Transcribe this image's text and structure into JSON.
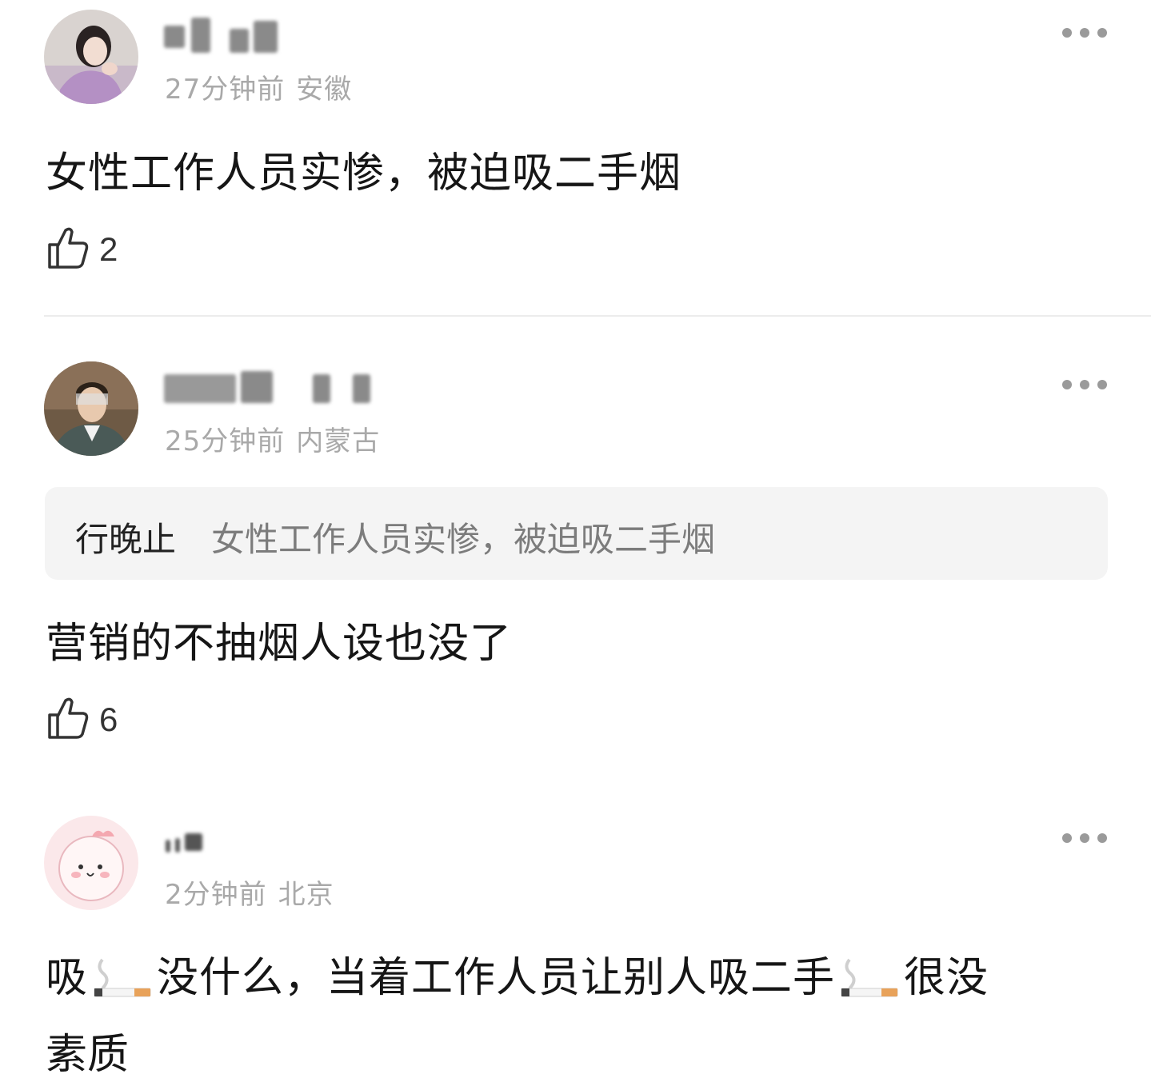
{
  "comments": [
    {
      "time": "27分钟前",
      "location": "安徽",
      "text": "女性工作人员实惨，被迫吸二手烟",
      "likes": "2",
      "avatar": "girl-photo-avatar"
    },
    {
      "time": "25分钟前",
      "location": "内蒙古",
      "reply_to": {
        "author": "行晚止",
        "text": "女性工作人员实惨，被迫吸二手烟"
      },
      "text": "营销的不抽烟人设也没了",
      "likes": "6",
      "avatar": "man-photo-avatar"
    },
    {
      "time": "2分钟前",
      "location": "北京",
      "text_parts": [
        "吸",
        "没什么，当着工作人员让别人吸二手",
        "很没"
      ],
      "text_line2": "素质",
      "emoji": "cigarette-emoji",
      "avatar": "cartoon-pink-avatar"
    }
  ],
  "icons": {
    "like": "thumbs-up-icon",
    "more": "more-dots-icon"
  }
}
